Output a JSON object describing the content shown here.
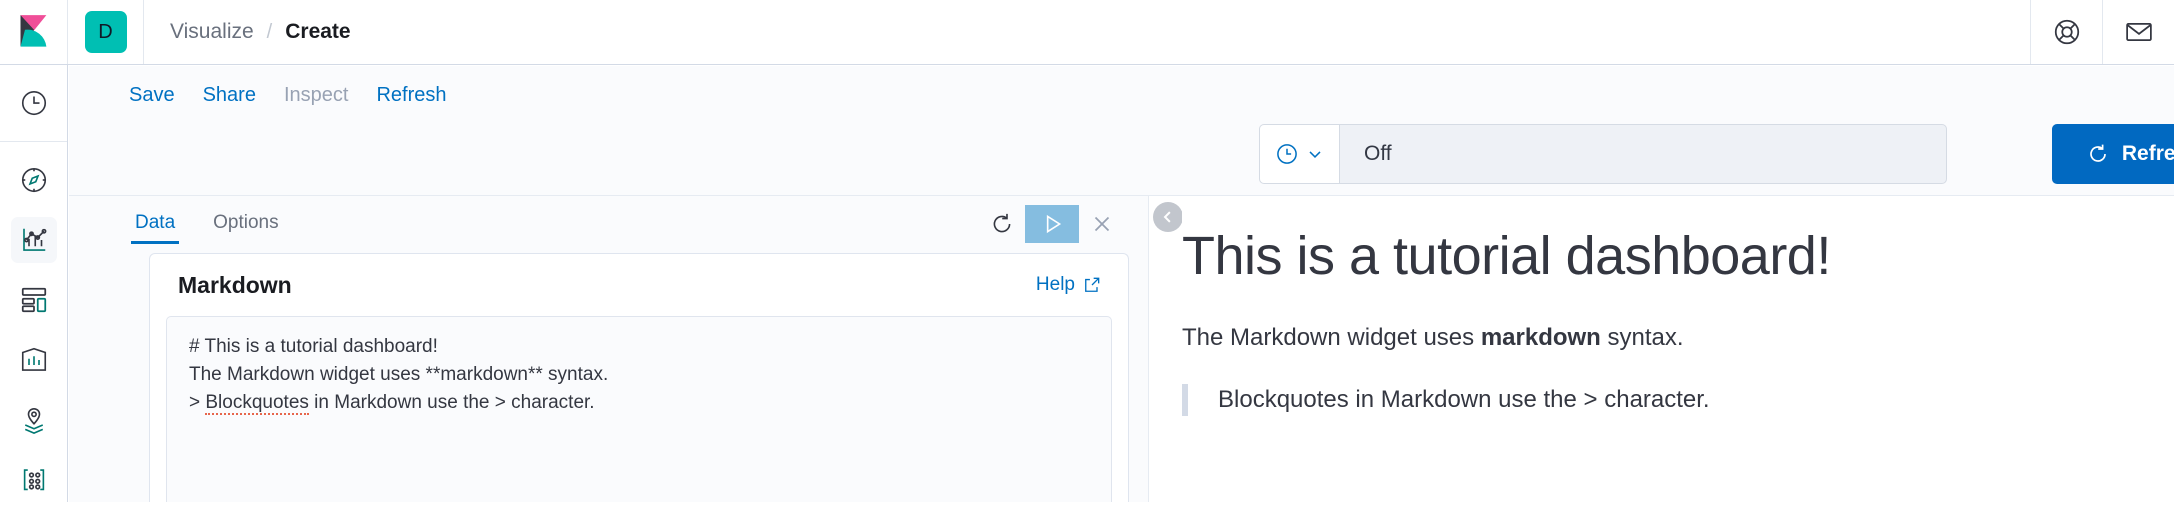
{
  "header": {
    "logo_icon": "kibana-logo",
    "space_badge": "D",
    "breadcrumb_parent": "Visualize",
    "breadcrumb_separator": "/",
    "breadcrumb_current": "Create",
    "help_icon": "lifebuoy-icon",
    "mail_icon": "envelope-icon"
  },
  "sidebar": {
    "items": [
      {
        "name": "recently-viewed",
        "icon": "clock-icon",
        "active": false
      },
      {
        "name": "discover",
        "icon": "compass-icon",
        "active": false
      },
      {
        "name": "visualize",
        "icon": "visualize-chart-icon",
        "active": true
      },
      {
        "name": "dashboard",
        "icon": "dashboard-grid-icon",
        "active": false
      },
      {
        "name": "canvas",
        "icon": "canvas-frame-icon",
        "active": false
      },
      {
        "name": "maps",
        "icon": "map-pin-layers-icon",
        "active": false
      },
      {
        "name": "machine-learning",
        "icon": "machine-learning-icon",
        "active": false
      }
    ]
  },
  "toolbar": {
    "save_label": "Save",
    "share_label": "Share",
    "inspect_label": "Inspect",
    "inspect_disabled": true,
    "refresh_label": "Refresh"
  },
  "timepicker": {
    "quick_icon": "clock-icon",
    "chevron_icon": "chevron-down-icon",
    "value": "Off",
    "refresh_button_label": "Refresh",
    "refresh_button_icon": "refresh-icon",
    "refresh_button_color": "#0169c1"
  },
  "editor": {
    "tabs": [
      {
        "label": "Data",
        "active": true
      },
      {
        "label": "Options",
        "active": false
      }
    ],
    "actions": [
      {
        "name": "reset-changes",
        "icon": "refresh-icon"
      },
      {
        "name": "apply-changes",
        "icon": "play-icon",
        "highlighted": true
      },
      {
        "name": "discard-changes",
        "icon": "close-icon"
      }
    ],
    "collapse_icon": "chevron-left-circle-icon",
    "card_title": "Markdown",
    "help_label": "Help",
    "help_icon": "external-link-icon",
    "markdown_source": "# This is a tutorial dashboard!\nThe Markdown widget uses **markdown** syntax.\n> Blockquotes in Markdown use the > character.",
    "spellcheck_word": "Blockquotes"
  },
  "preview": {
    "heading": "This is a tutorial dashboard!",
    "paragraph_before": "The Markdown widget uses ",
    "paragraph_bold": "markdown",
    "paragraph_after": " syntax.",
    "blockquote": "Blockquotes in Markdown use the > character."
  },
  "colors": {
    "accent_blue": "#0071c2",
    "kibana_pink": "#f04e98",
    "kibana_teal": "#00BFB3",
    "kibana_dark": "#343741"
  }
}
